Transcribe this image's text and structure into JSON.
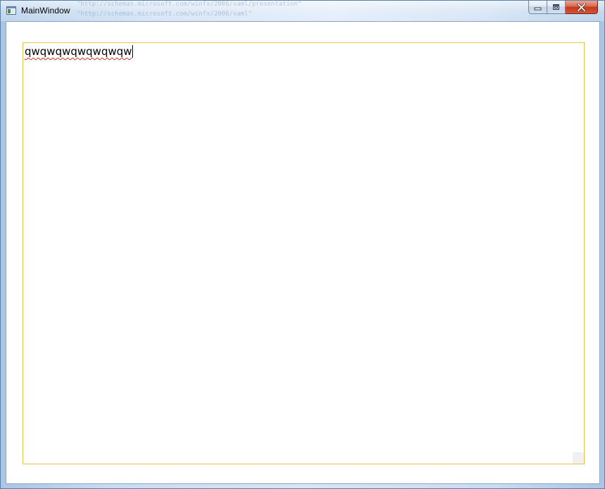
{
  "window": {
    "title": "MainWindow",
    "icon": "wpf-window-icon",
    "background_ghost_lines": [
      "\"http://schemas.microsoft.com/winfx/2006/xaml/presentation\"",
      "\"http://schemas.microsoft.com/winfx/2006/xaml\""
    ],
    "caption_buttons": {
      "minimize": "minimize-icon",
      "maximize": "maximize-icon",
      "close": "close-icon"
    }
  },
  "textbox": {
    "value": "qwqwqwqwqwqwqw",
    "misspelled": true,
    "has_focus": true,
    "border_color": "#e8c44c"
  },
  "colors": {
    "close_button": "#c94a2c",
    "focus_border": "#e8c44c",
    "spellcheck_underline": "#e0302a"
  }
}
